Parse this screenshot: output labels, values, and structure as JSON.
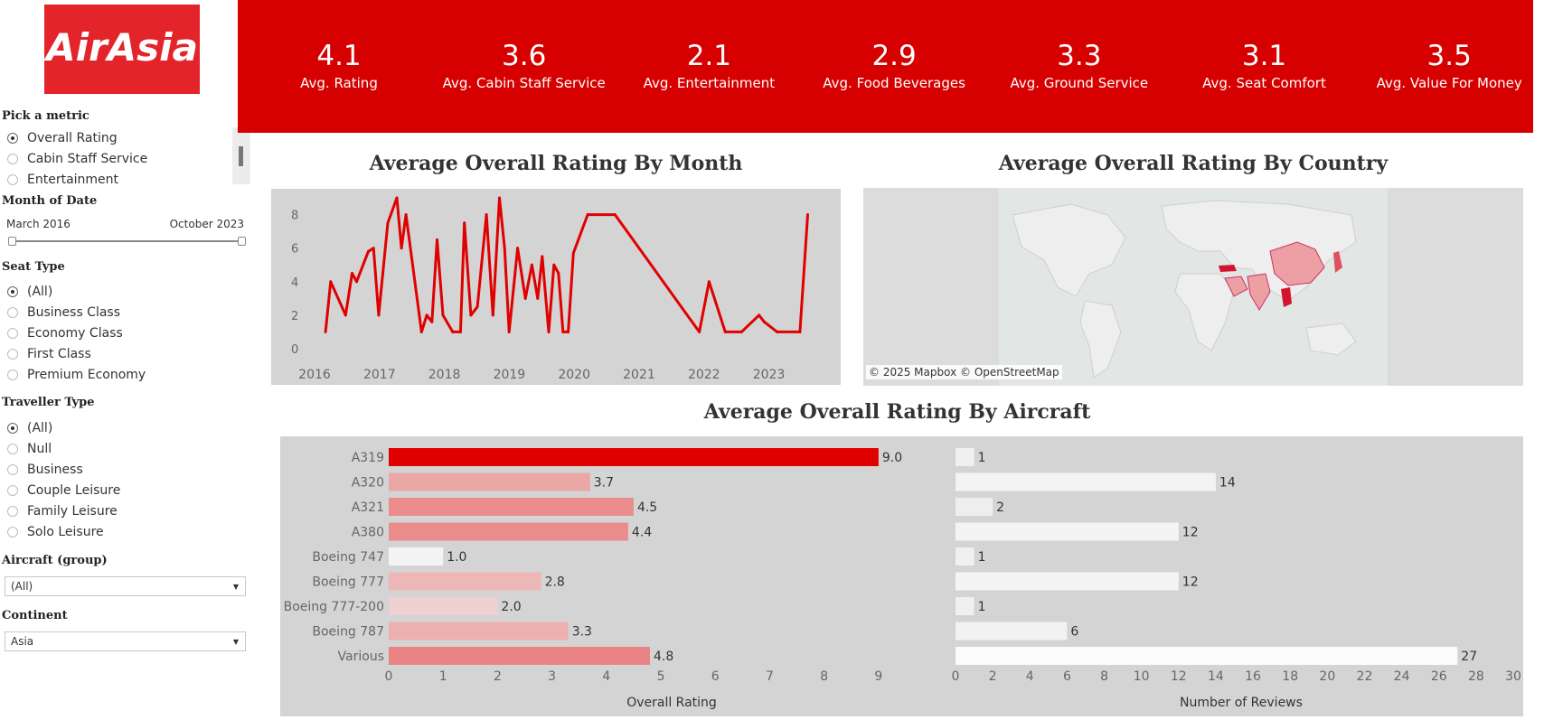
{
  "brand": {
    "logo_text": "AirAsia",
    "color": "#d60000"
  },
  "filters": {
    "metric": {
      "title": "Pick a metric",
      "options": [
        "Overall Rating",
        "Cabin Staff Service",
        "Entertainment"
      ],
      "selected": "Overall Rating"
    },
    "date": {
      "title": "Month of Date",
      "start": "March 2016",
      "end": "October 2023"
    },
    "seat_type": {
      "title": "Seat Type",
      "options": [
        "(All)",
        "Business Class",
        "Economy Class",
        "First Class",
        "Premium Economy"
      ],
      "selected": "(All)"
    },
    "traveller_type": {
      "title": "Traveller Type",
      "options": [
        "(All)",
        "Null",
        "Business",
        "Couple Leisure",
        "Family Leisure",
        "Solo Leisure"
      ],
      "selected": "(All)"
    },
    "aircraft": {
      "title": "Aircraft (group)",
      "value": "(All)"
    },
    "continent": {
      "title": "Continent",
      "value": "Asia"
    }
  },
  "kpis": [
    {
      "value": "4.1",
      "label": "Avg. Rating"
    },
    {
      "value": "3.6",
      "label": "Avg. Cabin Staff Service"
    },
    {
      "value": "2.1",
      "label": "Avg. Entertainment"
    },
    {
      "value": "2.9",
      "label": "Avg. Food Beverages"
    },
    {
      "value": "3.3",
      "label": "Avg. Ground Service"
    },
    {
      "value": "3.1",
      "label": "Avg. Seat Comfort"
    },
    {
      "value": "3.5",
      "label": "Avg. Value For Money"
    }
  ],
  "titles": {
    "month": "Average Overall Rating By Month",
    "country": "Average Overall Rating By Country",
    "aircraft": "Average Overall Rating By Aircraft"
  },
  "map": {
    "attribution": "© 2025 Mapbox © OpenStreetMap"
  },
  "chart_data": [
    {
      "type": "line",
      "x_ticks": [
        "2016",
        "2017",
        "2018",
        "2019",
        "2020",
        "2021",
        "2022",
        "2023"
      ],
      "y_ticks": [
        "0",
        "2",
        "4",
        "6",
        "8"
      ],
      "ylim": [
        0,
        9
      ],
      "xlim": [
        2016.0,
        2023.8
      ],
      "color": "#e00000",
      "x": [
        2016.14,
        2016.22,
        2016.45,
        2016.55,
        2016.62,
        2016.8,
        2016.88,
        2016.96,
        2017.1,
        2017.24,
        2017.31,
        2017.38,
        2017.62,
        2017.7,
        2017.78,
        2017.86,
        2017.95,
        2018.1,
        2018.22,
        2018.28,
        2018.38,
        2018.48,
        2018.62,
        2018.72,
        2018.82,
        2018.9,
        2018.97,
        2019.1,
        2019.22,
        2019.32,
        2019.41,
        2019.48,
        2019.58,
        2019.66,
        2019.73,
        2019.8,
        2019.88,
        2019.96,
        2020.18,
        2020.6,
        2021.9,
        2022.05,
        2022.3,
        2022.55,
        2022.82,
        2022.9,
        2023.1,
        2023.45,
        2023.57
      ],
      "y": [
        1,
        4,
        2,
        4.5,
        4,
        5.8,
        6,
        2,
        7.5,
        9,
        6,
        8,
        1,
        2,
        1.6,
        6.5,
        2,
        1,
        1,
        7.5,
        2,
        2.5,
        8,
        2,
        9,
        6,
        1,
        6,
        3,
        5,
        3,
        5.5,
        1,
        5,
        4.5,
        1,
        1,
        5.7,
        8,
        8,
        1,
        4,
        1,
        1,
        2,
        1.6,
        1,
        1,
        8
      ]
    },
    {
      "type": "bar",
      "orientation": "horizontal",
      "categories": [
        "A319",
        "A320",
        "A321",
        "A380",
        "Boeing 747",
        "Boeing 777",
        "Boeing 777-200",
        "Boeing 787",
        "Various"
      ],
      "values": [
        9.0,
        3.7,
        4.5,
        4.4,
        1.0,
        2.8,
        2.0,
        3.3,
        4.8
      ],
      "colors": [
        "#e00000",
        "#eba6a6",
        "#ea8c8c",
        "#ea8c8c",
        "#f4f4f4",
        "#edb7b7",
        "#f0d0d0",
        "#edb0b0",
        "#ea8484"
      ],
      "xlabel": "Overall Rating",
      "x_ticks": [
        0,
        1,
        2,
        3,
        4,
        5,
        6,
        7,
        8,
        9
      ],
      "xlim": [
        0,
        9.6
      ]
    },
    {
      "type": "bar",
      "orientation": "horizontal",
      "categories": [
        "A319",
        "A320",
        "A321",
        "A380",
        "Boeing 747",
        "Boeing 777",
        "Boeing 777-200",
        "Boeing 787",
        "Various"
      ],
      "values": [
        1,
        14,
        2,
        12,
        1,
        12,
        1,
        6,
        27
      ],
      "xlabel": "Number of Reviews",
      "x_ticks": [
        0,
        2,
        4,
        6,
        8,
        10,
        12,
        14,
        16,
        18,
        20,
        22,
        24,
        26,
        28,
        30
      ],
      "xlim": [
        0,
        30
      ],
      "colors": [
        "#f0f0f0",
        "#f3f3f3",
        "#eeeeee",
        "#f4f4f4",
        "#f0f0f0",
        "#f4f4f4",
        "#f0f0f0",
        "#f2f2f2",
        "#fbfbfb"
      ]
    }
  ]
}
